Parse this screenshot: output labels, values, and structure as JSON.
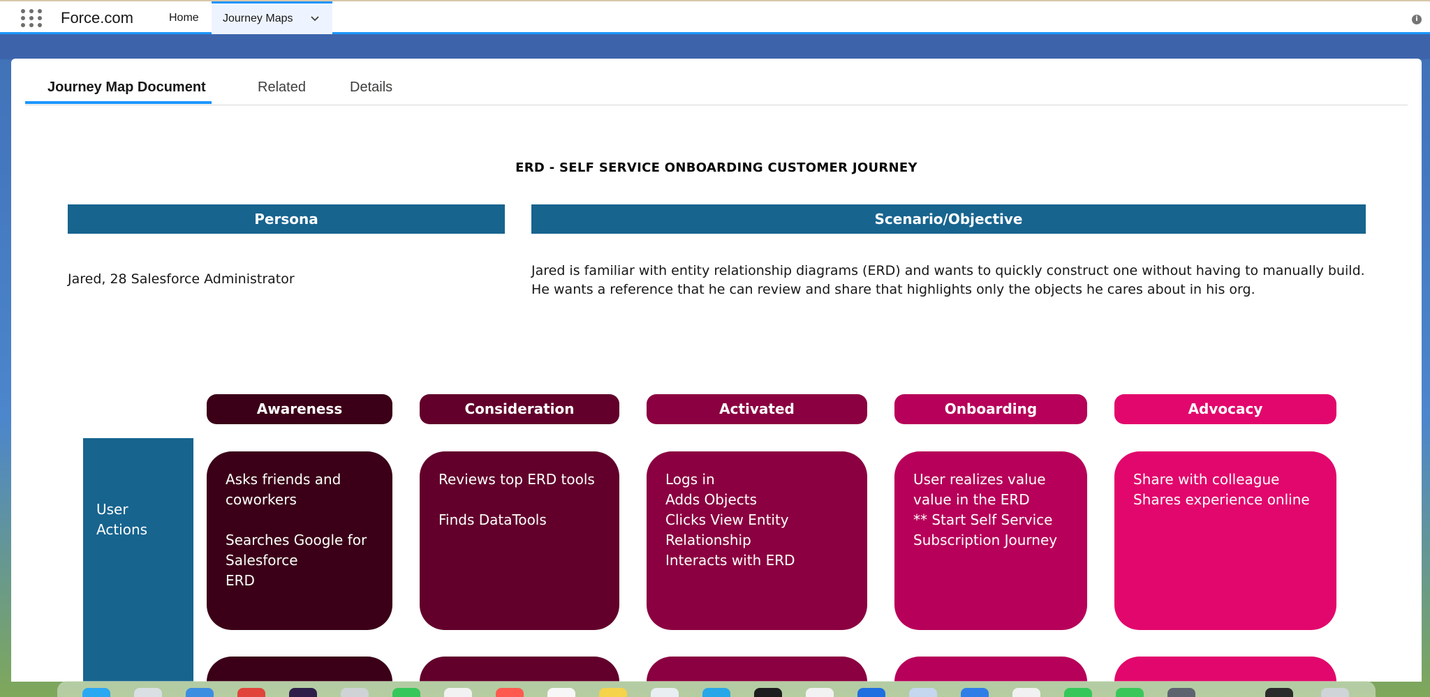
{
  "app": {
    "brand": "Force.com",
    "nav": [
      {
        "label": "Home"
      },
      {
        "label": "Journey Maps"
      }
    ]
  },
  "tabs": [
    {
      "label": "Journey Map Document",
      "active": true
    },
    {
      "label": "Related",
      "active": false
    },
    {
      "label": "Details",
      "active": false
    }
  ],
  "document": {
    "title": "ERD - SELF SERVICE ONBOARDING CUSTOMER JOURNEY",
    "persona_header": "Persona",
    "scenario_header": "Scenario/Objective",
    "persona_text": "Jared, 28 Salesforce Administrator",
    "scenario_text": "Jared is familiar with entity relationship diagrams (ERD) and wants to quickly construct one without having to manually build. He wants a reference that he can review and share that highlights only the objects he cares about in his org."
  },
  "journey": {
    "stages": [
      {
        "label": "Awareness",
        "color": "#3b0017"
      },
      {
        "label": "Consideration",
        "color": "#62002b"
      },
      {
        "label": "Activated",
        "color": "#8b0040"
      },
      {
        "label": "Onboarding",
        "color": "#b70059"
      },
      {
        "label": "Advocacy",
        "color": "#e2076c"
      }
    ],
    "row_label": "User\nActions",
    "cells": [
      "Asks friends and\ncoworkers\n\nSearches Google for\nSalesforce\nERD",
      "Reviews top ERD tools\n\nFinds DataTools",
      "Logs in\nAdds Objects\nClicks View Entity\nRelationship\nInteracts with ERD",
      "User realizes value\nvalue in the ERD\n** Start Self Service\nSubscription Journey",
      "Share with colleague\nShares experience online"
    ]
  },
  "colors": {
    "header_blue": "#17648f",
    "accent": "#1b96ff"
  },
  "icons": {
    "app_launcher": "waffle-grid-icon",
    "nav_dropdown": "chevron-down-icon",
    "info": "info-icon"
  }
}
